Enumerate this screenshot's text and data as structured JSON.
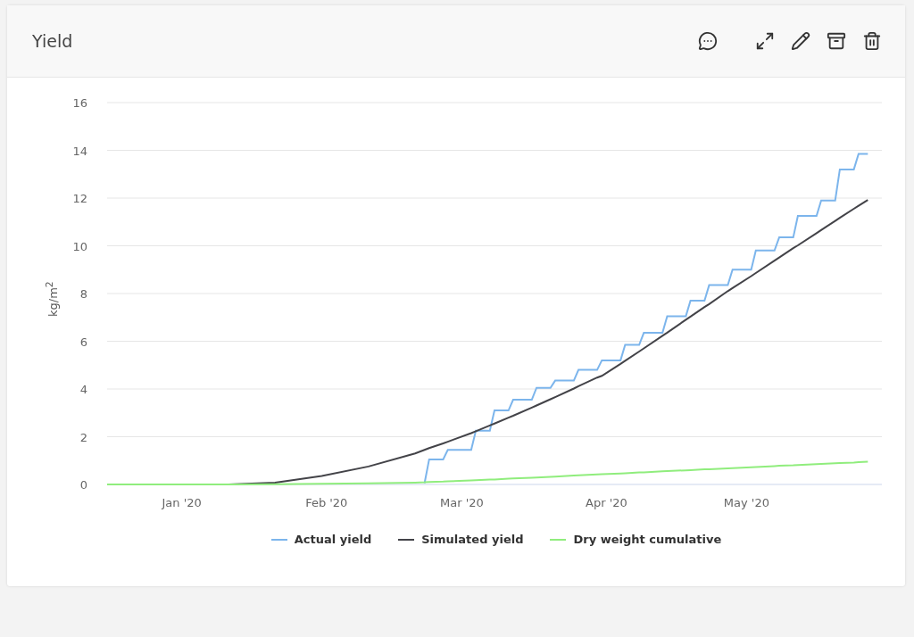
{
  "card": {
    "title": "Yield",
    "chart_data": {
      "type": "line",
      "grid": true,
      "ylabel": "kg/m$^{2}$",
      "xlim": [
        "2019-12-16",
        "2020-05-30"
      ],
      "ylim": [
        0,
        16
      ],
      "yticks": [
        0,
        2,
        4,
        6,
        8,
        10,
        12,
        14,
        16
      ],
      "xticks": [
        {
          "value": "2020-01-01",
          "label": "Jan '20"
        },
        {
          "value": "2020-02-01",
          "label": "Feb '20"
        },
        {
          "value": "2020-03-01",
          "label": "Mar '20"
        },
        {
          "value": "2020-04-01",
          "label": "Apr '20"
        },
        {
          "value": "2020-05-01",
          "label": "May '20"
        }
      ],
      "x": [
        "2019-12-16",
        "2020-01-01",
        "2020-01-11",
        "2020-01-21",
        "2020-01-31",
        "2020-02-10",
        "2020-02-20",
        "2020-02-22",
        "2020-02-23",
        "2020-02-26",
        "2020-02-27",
        "2020-03-03",
        "2020-03-04",
        "2020-03-07",
        "2020-03-08",
        "2020-03-11",
        "2020-03-12",
        "2020-03-16",
        "2020-03-17",
        "2020-03-20",
        "2020-03-21",
        "2020-03-25",
        "2020-03-26",
        "2020-03-30",
        "2020-03-31",
        "2020-04-04",
        "2020-04-05",
        "2020-04-08",
        "2020-04-09",
        "2020-04-13",
        "2020-04-14",
        "2020-04-18",
        "2020-04-19",
        "2020-04-22",
        "2020-04-23",
        "2020-04-27",
        "2020-04-28",
        "2020-05-02",
        "2020-05-03",
        "2020-05-07",
        "2020-05-08",
        "2020-05-11",
        "2020-05-12",
        "2020-05-16",
        "2020-05-17",
        "2020-05-20",
        "2020-05-21",
        "2020-05-24",
        "2020-05-25",
        "2020-05-27"
      ],
      "series": [
        {
          "name": "Actual yield",
          "color": "#7cb5ec",
          "values": [
            null,
            null,
            null,
            null,
            null,
            null,
            null,
            0.05,
            1.05,
            1.05,
            1.45,
            1.45,
            2.25,
            2.25,
            3.1,
            3.1,
            3.55,
            3.55,
            4.05,
            4.05,
            4.35,
            4.35,
            4.8,
            4.8,
            5.2,
            5.2,
            5.85,
            5.85,
            6.35,
            6.35,
            7.05,
            7.05,
            7.7,
            7.7,
            8.35,
            8.35,
            9.0,
            9.0,
            9.8,
            9.8,
            10.35,
            10.35,
            11.25,
            11.25,
            11.9,
            11.9,
            13.2,
            13.2,
            13.85,
            13.85
          ]
        },
        {
          "name": "Simulated yield",
          "color": "#434348",
          "values": [
            0,
            0,
            0,
            0.08,
            0.35,
            0.75,
            1.3,
            1.45,
            1.52,
            1.72,
            1.79,
            2.15,
            2.23,
            2.47,
            2.55,
            2.8,
            2.88,
            3.22,
            3.31,
            3.57,
            3.66,
            4.02,
            4.12,
            4.48,
            4.55,
            5.05,
            5.18,
            5.57,
            5.7,
            6.23,
            6.36,
            6.9,
            7.03,
            7.43,
            7.56,
            8.1,
            8.23,
            8.73,
            8.86,
            9.38,
            9.51,
            9.9,
            10.02,
            10.53,
            10.66,
            11.04,
            11.17,
            11.55,
            11.68,
            11.92
          ]
        },
        {
          "name": "Dry weight cumulative",
          "color": "#90ed7d",
          "values": [
            0,
            0,
            0,
            0.01,
            0.03,
            0.05,
            0.08,
            0.09,
            0.1,
            0.12,
            0.13,
            0.17,
            0.18,
            0.2,
            0.21,
            0.24,
            0.25,
            0.28,
            0.29,
            0.32,
            0.33,
            0.37,
            0.38,
            0.42,
            0.43,
            0.46,
            0.47,
            0.5,
            0.51,
            0.55,
            0.56,
            0.59,
            0.6,
            0.63,
            0.64,
            0.67,
            0.68,
            0.72,
            0.73,
            0.77,
            0.78,
            0.8,
            0.81,
            0.85,
            0.86,
            0.89,
            0.9,
            0.92,
            0.93,
            0.95
          ]
        }
      ]
    }
  }
}
